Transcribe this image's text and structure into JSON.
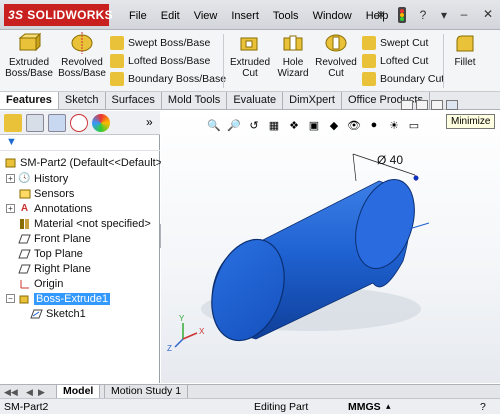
{
  "app": {
    "logo_text": "SOLIDWORKS",
    "logo_mark": "3S"
  },
  "menu": [
    "File",
    "Edit",
    "View",
    "Insert",
    "Tools",
    "Window",
    "Help"
  ],
  "ribbon": {
    "extruded_boss": "Extruded Boss/Base",
    "revolved_boss": "Revolved Boss/Base",
    "swept_boss": "Swept Boss/Base",
    "lofted_boss": "Lofted Boss/Base",
    "boundary_boss": "Boundary Boss/Base",
    "extruded_cut": "Extruded Cut",
    "hole_wizard": "Hole Wizard",
    "revolved_cut": "Revolved Cut",
    "swept_cut": "Swept Cut",
    "lofted_cut": "Lofted Cut",
    "boundary_cut": "Boundary Cut",
    "fillet": "Fillet"
  },
  "tabs": [
    "Features",
    "Sketch",
    "Surfaces",
    "Mold Tools",
    "Evaluate",
    "DimXpert",
    "Office Products"
  ],
  "tree": {
    "root": "SM-Part2  (Default<<Default>_D",
    "items": [
      "History",
      "Sensors",
      "Annotations",
      "Material <not specified>",
      "Front Plane",
      "Top Plane",
      "Right Plane",
      "Origin",
      "Boss-Extrude1",
      "Sketch1"
    ]
  },
  "viewport": {
    "dimension": "Ø 40",
    "tooltip": "Minimize",
    "triad": {
      "x": "X",
      "y": "Y",
      "z": "Z"
    }
  },
  "bottom_tabs": [
    "Model",
    "Motion Study 1"
  ],
  "status": {
    "doc": "SM-Part2",
    "mode": "Editing Part",
    "units": "MMGS"
  },
  "colors": {
    "part_blue": "#1e5fd0",
    "brand_red": "#c8201e",
    "selection": "#3399ff"
  }
}
